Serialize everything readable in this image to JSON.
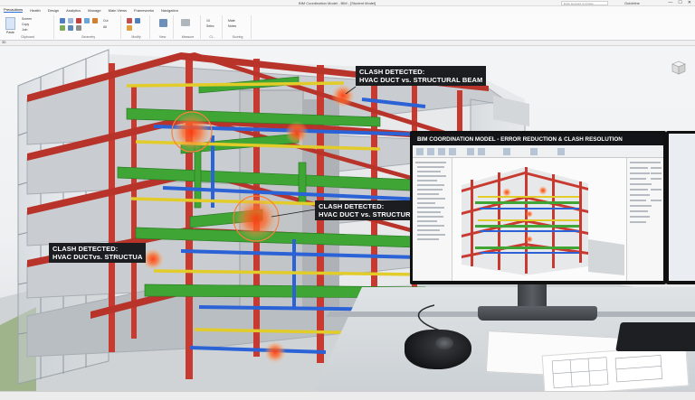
{
  "app": {
    "title": "BIM Coordination Model - BIM - [Student Model]",
    "search_placeholder": "Enter keyword or phrase",
    "user": "Guideline",
    "window_buttons": [
      "—",
      "☐",
      "✕"
    ]
  },
  "ribbon": {
    "tabs": [
      "Precautions",
      "Health",
      "Design",
      "Analytics",
      "Manage",
      "Main Views",
      "Frameworks",
      "Navigation"
    ],
    "active_tab_index": 0,
    "groups": [
      {
        "label": "Clipboard",
        "items": [
          "Paste",
          "Screen",
          "Copy",
          "Join"
        ]
      },
      {
        "label": "Geometry",
        "items": [
          "Cut",
          "All"
        ]
      },
      {
        "label": "Modify"
      },
      {
        "label": "View"
      },
      {
        "label": "Measure"
      },
      {
        "label": "Cl...",
        "items": [
          "10",
          "Selec"
        ]
      },
      {
        "label": "Scoring",
        "items": [
          "Mate",
          "Notes"
        ]
      }
    ],
    "view_tab": "3D"
  },
  "clash_callouts": [
    {
      "title": "CLASH DETECTED:",
      "detail": "HVAC DUCT vs. STRUCTURAL BEAM"
    },
    {
      "title": "CLASH DETECTED:",
      "detail": "HVAC DUCT vs. STRUCTURAL BE"
    },
    {
      "title": "CLASH DETECTED:",
      "detail": "HVAC DUCTvs. STRUCTUA"
    }
  ],
  "monitor": {
    "header": "BIM COORDINATION MODEL - ERROR REDUCTION & CLASH RESOLUTION"
  },
  "colors": {
    "structure": "#c8392f",
    "hvac": "#3fa535",
    "plumbing": "#2b63d6",
    "electrical": "#e2cc2a",
    "clash": "#ff5a1f",
    "callout_bg": "#1b1d20"
  },
  "icons": [
    "home-icon",
    "paste-icon",
    "cut-icon",
    "copy-icon",
    "viewcube-icon",
    "3d-mouse-icon",
    "keyboard-icon"
  ]
}
